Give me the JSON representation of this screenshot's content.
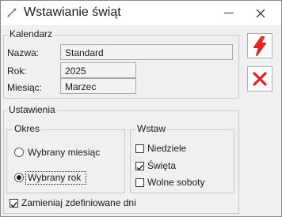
{
  "window": {
    "title": "Wstawianie świąt"
  },
  "kalendarz": {
    "legend": "Kalendarz",
    "nazwa_label": "Nazwa:",
    "nazwa_value": "Standard",
    "rok_label": "Rok:",
    "rok_value": "2025",
    "miesiac_label": "Miesiąc:",
    "miesiac_value": "Marzec"
  },
  "ustawienia": {
    "legend": "Ustawienia",
    "okres": {
      "legend": "Okres",
      "options": [
        {
          "label": "Wybrany miesiąc",
          "selected": false
        },
        {
          "label": "Wybrany rok",
          "selected": true
        }
      ]
    },
    "wstaw": {
      "legend": "Wstaw",
      "items": [
        {
          "label": "Niedziele",
          "checked": false
        },
        {
          "label": "Święta",
          "checked": true
        },
        {
          "label": "Wolne soboty",
          "checked": false
        }
      ]
    },
    "replace": {
      "label": "Zamieniaj zdefiniowane dni",
      "checked": true
    }
  },
  "actions": {
    "confirm_icon": "lightning-icon",
    "cancel_icon": "x-icon",
    "confirm_color": "#e0201b",
    "cancel_color": "#e0201b"
  }
}
